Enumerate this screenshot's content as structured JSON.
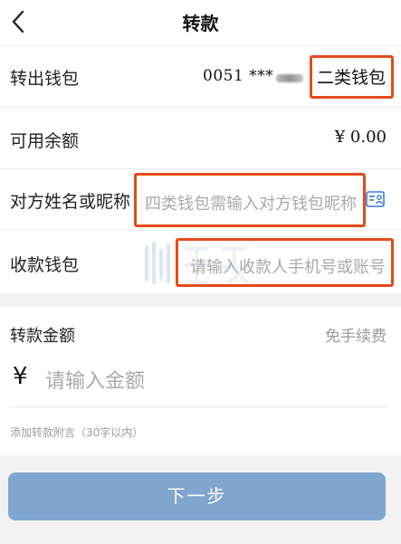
{
  "header": {
    "title": "转款"
  },
  "from_wallet": {
    "label": "转出钱包",
    "account": "0051 ***",
    "wallet_type": "二类钱包"
  },
  "balance": {
    "label": "可用余额",
    "value": "¥ 0.00"
  },
  "recipient_name": {
    "label": "对方姓名或昵称",
    "placeholder": "四类钱包需输入对方钱包昵称"
  },
  "receiving_wallet": {
    "label": "收款钱包",
    "placeholder": "请输入收款人手机号或账号"
  },
  "amount": {
    "label": "转款金额",
    "fee_label": "免手续费",
    "currency_symbol": "¥",
    "placeholder": "请输入金额"
  },
  "remark": {
    "placeholder": "添加转款附言（30字以内）"
  },
  "next_button": {
    "label": "下一步"
  },
  "colors": {
    "highlight_box": "#e64a19",
    "button": "#7fa6cf",
    "icon_blue": "#3a7bd5"
  },
  "icons": [
    "back-icon",
    "contact-card-icon"
  ]
}
